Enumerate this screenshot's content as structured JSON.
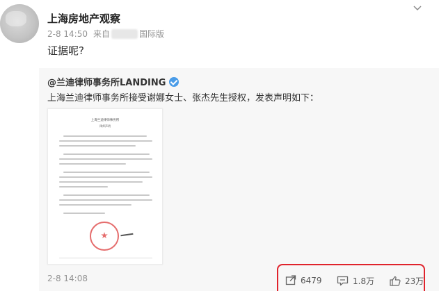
{
  "post": {
    "username": "上海房地产观察",
    "time": "2-8 14:50",
    "source_prefix": "来自",
    "source_suffix": "国际版",
    "text": "证据呢?"
  },
  "repost": {
    "author": "@兰迪律师事务所LANDING",
    "text": "上海兰迪律师事务所接受谢娜女士、张杰先生授权，发表声明如下：",
    "time": "2-8 14:08",
    "document": {
      "title": "上海兰迪律师事务所",
      "subtitle": "律师声明"
    }
  },
  "actions": {
    "repost_count": "6479",
    "comment_count": "1.8万",
    "like_count": "23万"
  },
  "icons": {
    "more": "chevron-down-icon",
    "verified": "verified-badge-icon",
    "repost": "repost-icon",
    "comment": "comment-icon",
    "like": "thumbs-up-icon"
  },
  "colors": {
    "highlight": "#e0232c",
    "verified": "#4a9ce8",
    "repost_bg": "#f7f7f7",
    "meta_text": "#939393"
  }
}
